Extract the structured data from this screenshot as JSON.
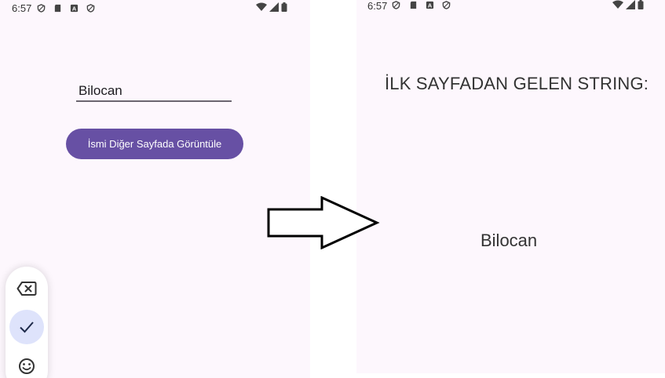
{
  "left_screen": {
    "status_bar": {
      "time": "6:57"
    },
    "name_input": {
      "value": "Bilocan"
    },
    "show_button": {
      "label": "İsmi Diğer Sayfada Görüntüle"
    },
    "keyboard_toolbar": {
      "icons": [
        "backspace-icon",
        "checkmark-icon",
        "emoji-icon"
      ]
    }
  },
  "right_screen": {
    "status_bar": {
      "time": "6:57"
    },
    "heading": "İLK SAYFADAN GELEN STRING:",
    "received_text": "Bilocan"
  },
  "colors": {
    "background": "#fdf7fd",
    "button": "#6750a4",
    "active_chip": "#dee3fb"
  }
}
